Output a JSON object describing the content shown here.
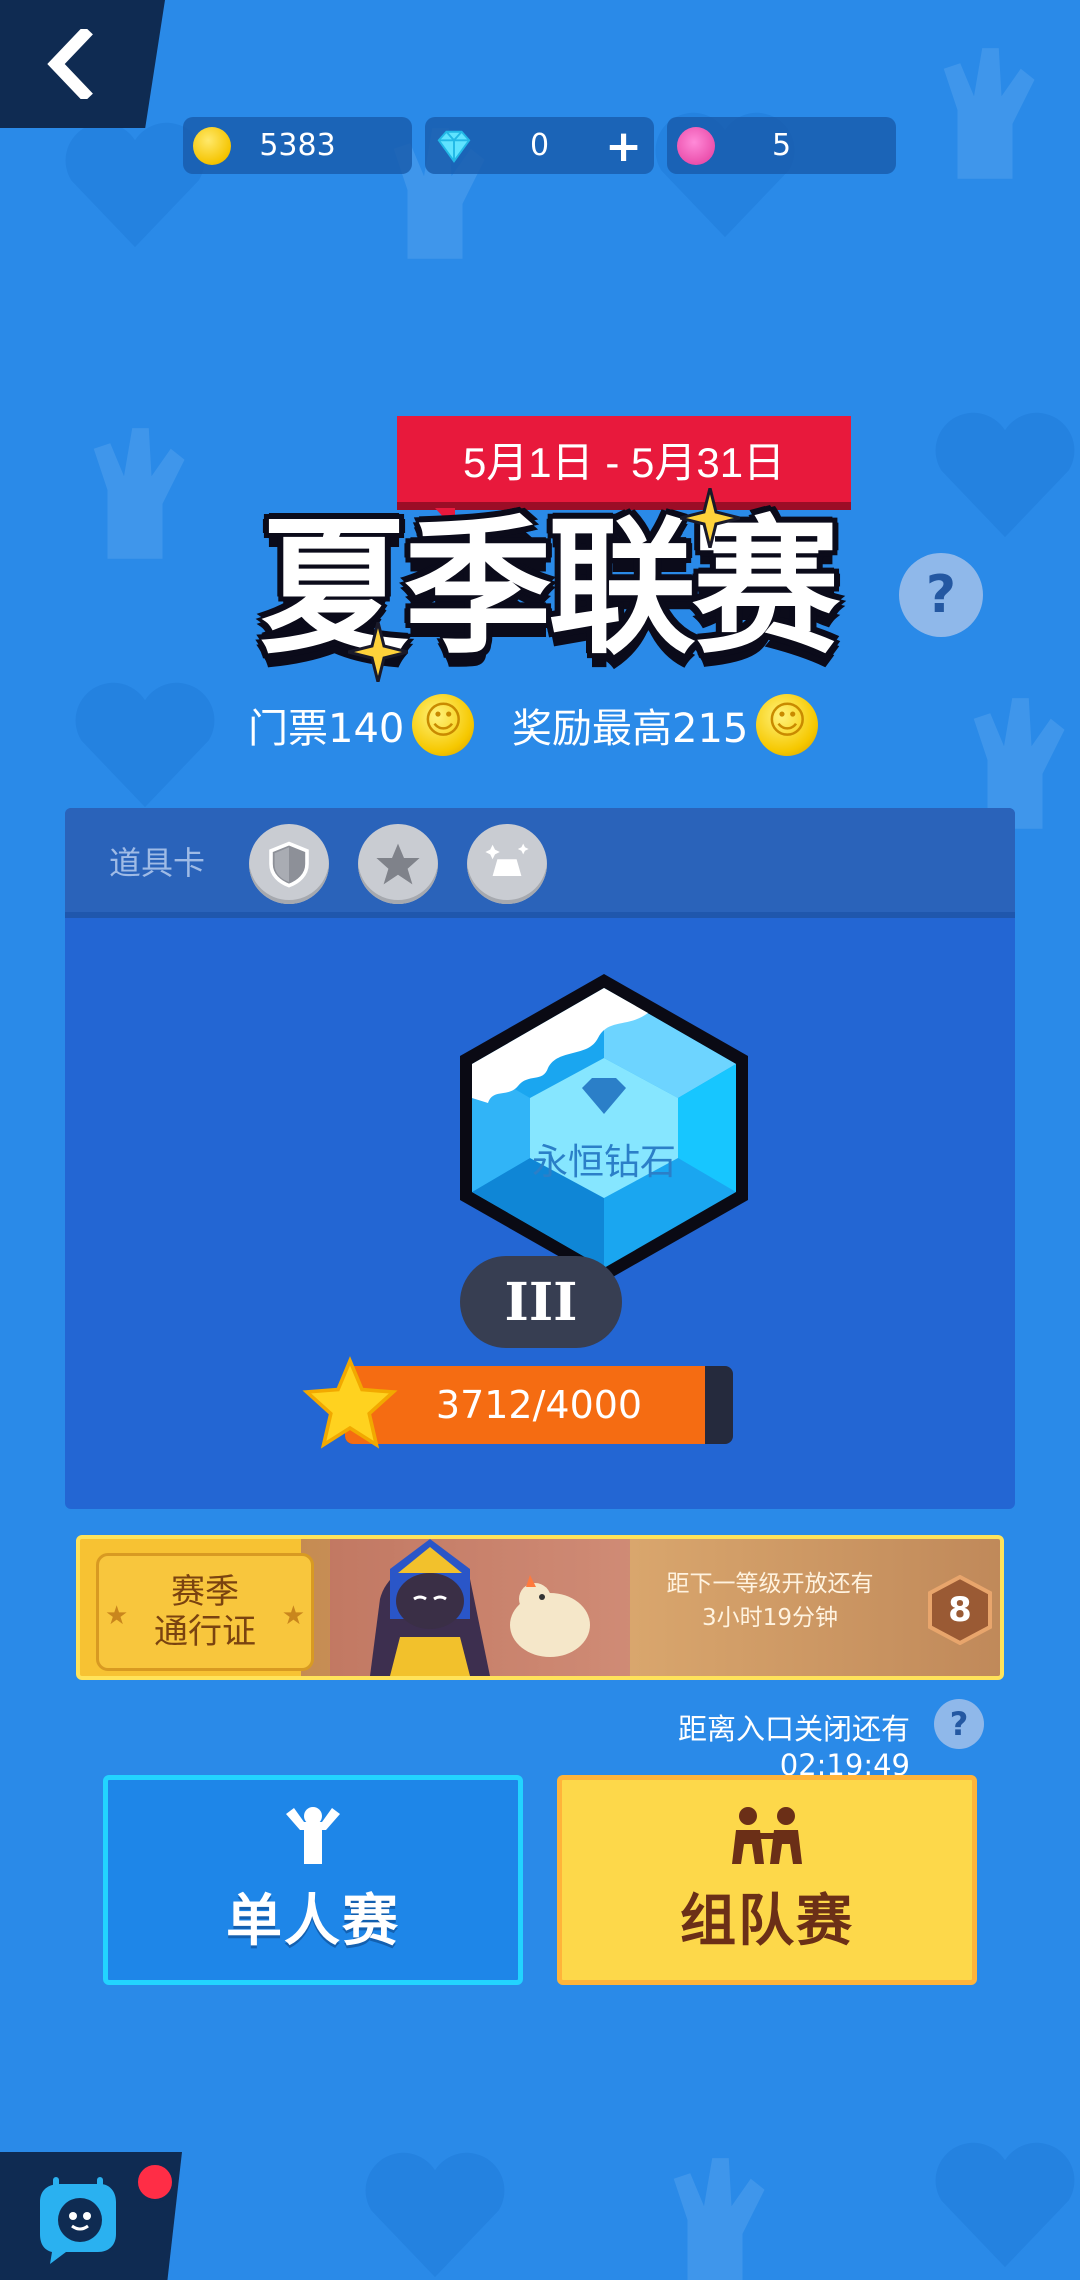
{
  "currency": {
    "coins": "5383",
    "gems": "0",
    "gems_add": "+",
    "lotus": "5"
  },
  "event": {
    "date_range": "5月1日 - 5月31日",
    "title": "夏季联赛",
    "help": "?",
    "ticket": "门票140",
    "reward": "奖励最高215"
  },
  "props": {
    "label": "道具卡",
    "items": [
      "shield-icon",
      "star-icon",
      "crown-sparkle-icon"
    ]
  },
  "rank": {
    "name": "永恒钻石",
    "tier": "III",
    "progress_text": "3712/4000",
    "progress_current": 3712,
    "progress_max": 4000
  },
  "season_pass": {
    "title_line1": "赛季",
    "title_line2": "通行证",
    "info_line1": "距下一等级开放还有",
    "info_line2": "3小时19分钟",
    "level": "8"
  },
  "entry": {
    "close_timer": "距离入口关闭还有 02:19:49",
    "help": "?"
  },
  "modes": {
    "solo": "单人赛",
    "team": "组队赛"
  },
  "colors": {
    "background": "#2a8ae8",
    "accent_red": "#e8193c",
    "progress_fill": "#f56c12",
    "solo_button": "#1e86e8",
    "team_button": "#fdd84a"
  }
}
